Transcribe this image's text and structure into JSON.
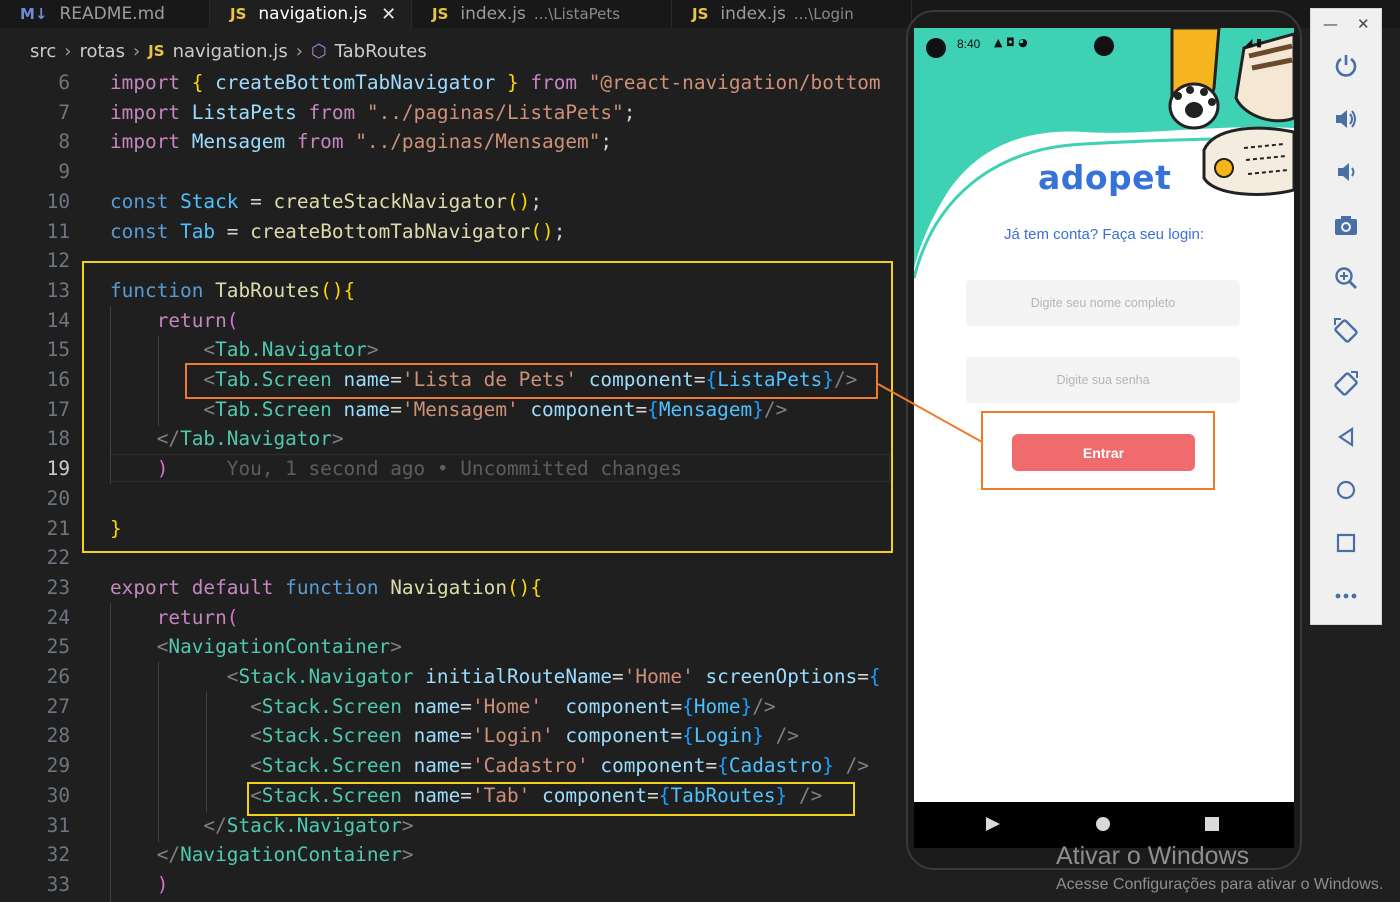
{
  "tabs": [
    {
      "icon": "M↓",
      "name": "README.md",
      "hint": "",
      "active": false
    },
    {
      "icon": "JS",
      "name": "navigation.js",
      "hint": "",
      "active": true
    },
    {
      "icon": "JS",
      "name": "index.js",
      "hint": "...\\ListaPets",
      "active": false
    },
    {
      "icon": "JS",
      "name": "index.js",
      "hint": "...\\Login",
      "active": false
    }
  ],
  "breadcrumb": {
    "folder1": "src",
    "folder2": "rotas",
    "js_badge": "JS",
    "file": "navigation.js",
    "symbol": "TabRoutes"
  },
  "code": {
    "line_numbers": [
      "6",
      "7",
      "8",
      "9",
      "10",
      "11",
      "12",
      "13",
      "14",
      "15",
      "16",
      "17",
      "18",
      "19",
      "20",
      "21",
      "22",
      "23",
      "24",
      "25",
      "26",
      "27",
      "28",
      "29",
      "30",
      "31",
      "32",
      "33"
    ],
    "blame": "You, 1 second ago • Uncommitted changes"
  },
  "app": {
    "status_time": "8:40",
    "logo": "adopet",
    "subtitle": "Já tem conta? Faça seu login:",
    "name_placeholder": "Digite seu nome completo",
    "password_placeholder": "Digite sua senha",
    "login_button": "Entrar"
  },
  "emulator_toolbar": {
    "minimize": "—",
    "close": "✕",
    "buttons": [
      "power-icon",
      "volume-up-icon",
      "volume-down-icon",
      "camera-icon",
      "zoom-icon",
      "rotate-left-icon",
      "rotate-right-icon",
      "back-icon",
      "home-icon",
      "overview-icon",
      "more-icon"
    ]
  },
  "watermark": {
    "line1": "Ativar o Windows",
    "line2": "Acesse Configurações para ativar o Windows."
  },
  "colors": {
    "accent_teal": "#3ed1b4",
    "brand_blue": "#3772d8",
    "button_coral": "#ef6b6e",
    "highlight_yellow": "#f2d11d",
    "highlight_orange": "#ee7b2d"
  }
}
